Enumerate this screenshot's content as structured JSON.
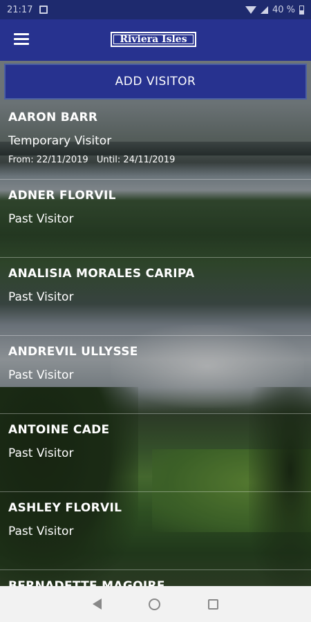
{
  "statusbar": {
    "time": "21:17",
    "battery": "40 %",
    "icons": [
      "image-icon",
      "wifi-icon",
      "signal-icon",
      "battery-icon"
    ]
  },
  "appbar": {
    "menu_icon": "hamburger-menu-icon",
    "logo_text": "Riviera Isles",
    "color": "#27328f"
  },
  "add_button": {
    "label": "ADD VISITOR"
  },
  "visitors": [
    {
      "name": "AARON BARR",
      "type": "Temporary Visitor",
      "from_label": "From:",
      "from": "22/11/2019",
      "until_label": "Until:",
      "until": "24/11/2019"
    },
    {
      "name": "ADNER FLORVIL",
      "type": "Past Visitor"
    },
    {
      "name": "ANALISIA MORALES CARIPA",
      "type": "Past Visitor"
    },
    {
      "name": "ANDREVIL ULLYSSE",
      "type": "Past Visitor"
    },
    {
      "name": "ANTOINE CADE",
      "type": "Past Visitor"
    },
    {
      "name": "ASHLEY FLORVIL",
      "type": "Past Visitor"
    },
    {
      "name": "BERNADETTE MAGOIRE",
      "type": ""
    }
  ],
  "navbar": {
    "icons": [
      "back-icon",
      "home-icon",
      "recent-apps-icon"
    ]
  }
}
